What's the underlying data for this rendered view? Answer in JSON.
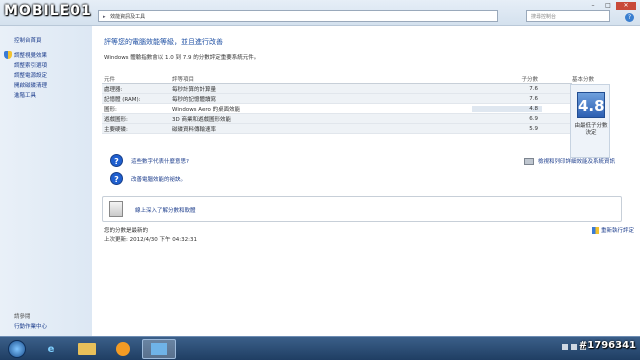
{
  "watermark_logo": "MOBILE01",
  "watermark_id": "#1796341",
  "address": {
    "path": "效能資訊及工具",
    "search_placeholder": "搜尋控制台"
  },
  "sidebar": {
    "home": "控制台首頁",
    "items": [
      {
        "label": "調整視覺效果",
        "icon": "shield-icon"
      },
      {
        "label": "調整索引選項",
        "icon": ""
      },
      {
        "label": "調整電源設定",
        "icon": ""
      },
      {
        "label": "開啟磁碟清理",
        "icon": ""
      },
      {
        "label": "進階工具",
        "icon": ""
      }
    ],
    "see_also": "請參閱",
    "action_center": "行動作業中心"
  },
  "main": {
    "title": "評等您的電腦效能等級，並且進行改善",
    "description": "Windows 體驗指數會以 1.0 到 7.9 的分數評定重要系統元件。",
    "headers": {
      "component": "元件",
      "rated": "評等項目",
      "subscore": "子分數",
      "basescore": "基本分數"
    },
    "rows": [
      {
        "component": "處理器:",
        "rated": "每秒計算的計算量",
        "score": "7.6"
      },
      {
        "component": "記憶體 (RAM):",
        "rated": "每秒的記憶體讀寫",
        "score": "7.6"
      },
      {
        "component": "圖形:",
        "rated": "Windows Aero 的桌面效能",
        "score": "4.8"
      },
      {
        "component": "遊戲圖形:",
        "rated": "3D 商業和遊戲圖形效能",
        "score": "6.9"
      },
      {
        "component": "主要硬碟:",
        "rated": "磁碟資料傳輸速率",
        "score": "5.9"
      }
    ],
    "base_score": "4.8",
    "base_caption": "由最低子分數決定",
    "links": {
      "what_mean": "這些數字代表什麼意思?",
      "improve": "改善電腦效能的祕訣。",
      "print": "檢視和列印詳細效能及系統資訊"
    },
    "online_link": "線上深入了解分數和軟體",
    "score_current": "您的分數是最新的",
    "last_update": "上次更新: 2012/4/30 下午 04:32:31",
    "rerun": "重新執行評定"
  }
}
